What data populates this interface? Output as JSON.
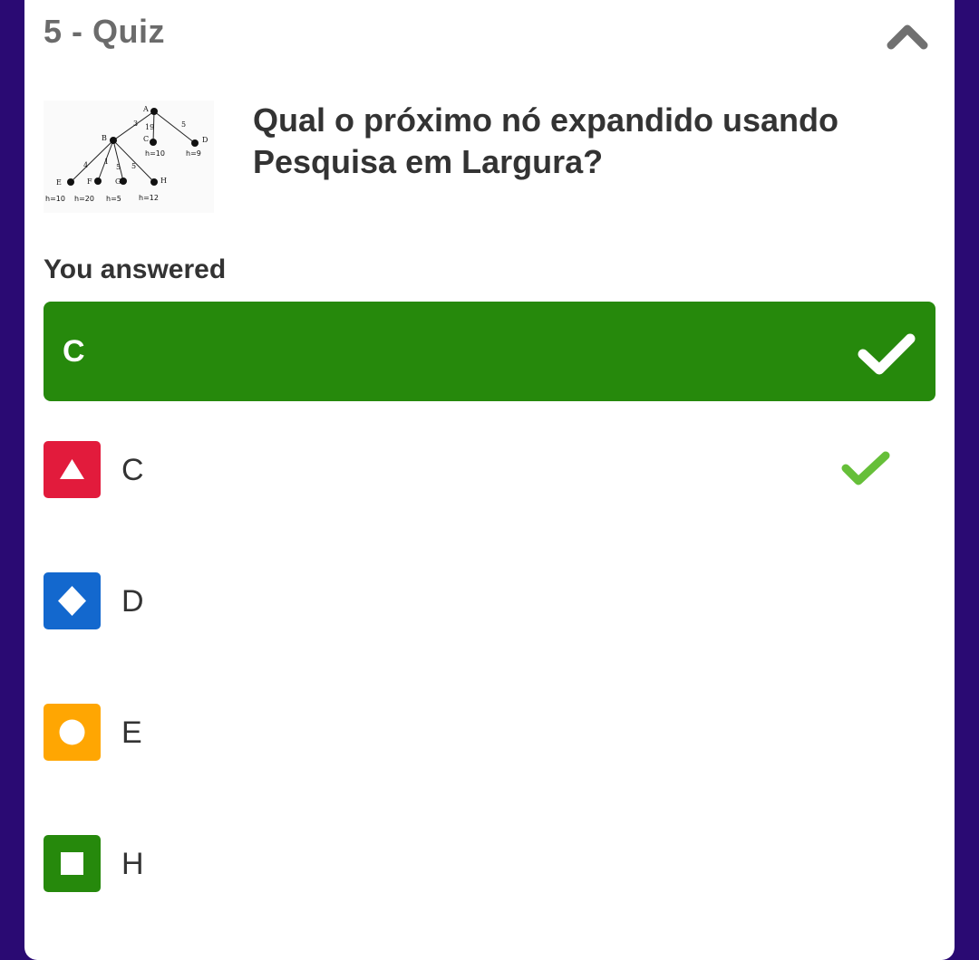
{
  "header": {
    "title": "5 - Quiz"
  },
  "question": {
    "text": "Qual o próximo nó expandido usando Pesquisa em Largura?",
    "image_labels": {
      "nodes": [
        "A",
        "B",
        "C",
        "D",
        "E",
        "F",
        "G",
        "H"
      ],
      "edges": [
        "3",
        "19",
        "5",
        "4",
        "1",
        "5",
        "5"
      ],
      "heuristics": [
        "h=10",
        "h=9",
        "h=10",
        "h=20",
        "h=5",
        "h=12"
      ]
    }
  },
  "result": {
    "label": "You answered",
    "answer": "C"
  },
  "options": [
    {
      "label": "C",
      "color": "#e21b3c",
      "shape": "triangle-icon",
      "correct": true
    },
    {
      "label": "D",
      "color": "#1368ce",
      "shape": "diamond-icon",
      "correct": false
    },
    {
      "label": "E",
      "color": "#ffa602",
      "shape": "circle-icon",
      "correct": false
    },
    {
      "label": "H",
      "color": "#26890c",
      "shape": "square-icon",
      "correct": false
    }
  ],
  "colors": {
    "background": "#2a0a73",
    "card": "#ffffff",
    "correct": "#26890c",
    "check": "#66bf39"
  }
}
